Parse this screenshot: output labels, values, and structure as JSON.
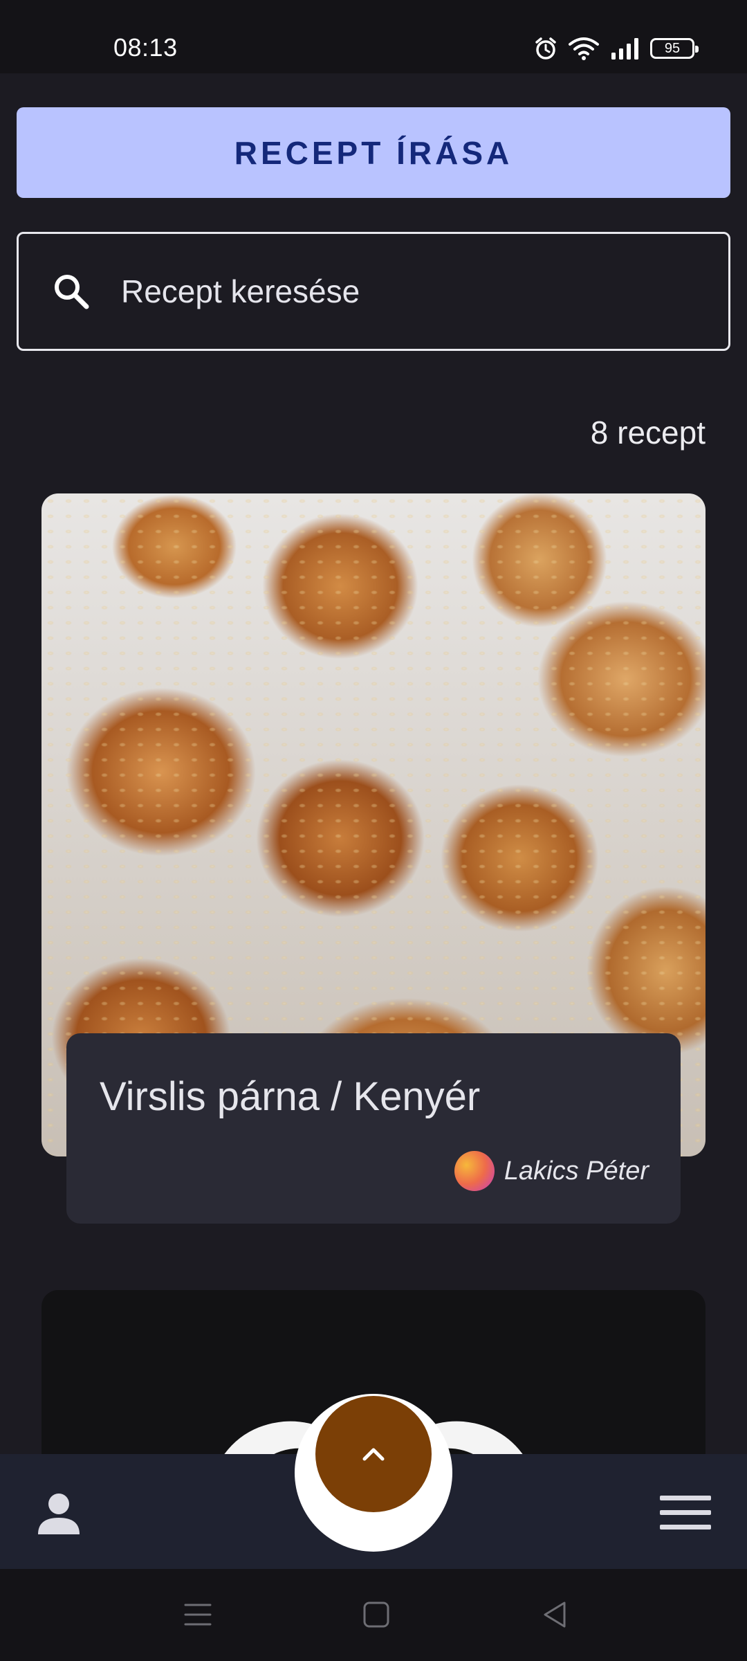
{
  "status_bar": {
    "time": "08:13",
    "battery": "95",
    "icons": [
      "alarm-icon",
      "wifi-icon",
      "signal-icon",
      "battery-icon"
    ]
  },
  "actions": {
    "write_recipe_label": "RECEPT ÍRÁSA"
  },
  "search": {
    "placeholder": "Recept keresése",
    "value": ""
  },
  "results": {
    "count_label": "8 recept"
  },
  "recipes": [
    {
      "title": "Virslis párna / Kenyér",
      "author": "Lakics Péter"
    }
  ],
  "bottom_nav": {
    "icons": [
      "profile-icon",
      "scroll-to-top-icon",
      "menu-icon"
    ]
  },
  "colors": {
    "background": "#1c1b22",
    "primary_button": "#b9c3ff",
    "primary_button_text": "#14287a",
    "card_panel": "#2a2a35",
    "fab": "#7b3f06",
    "nav_bar": "#1f2230"
  }
}
